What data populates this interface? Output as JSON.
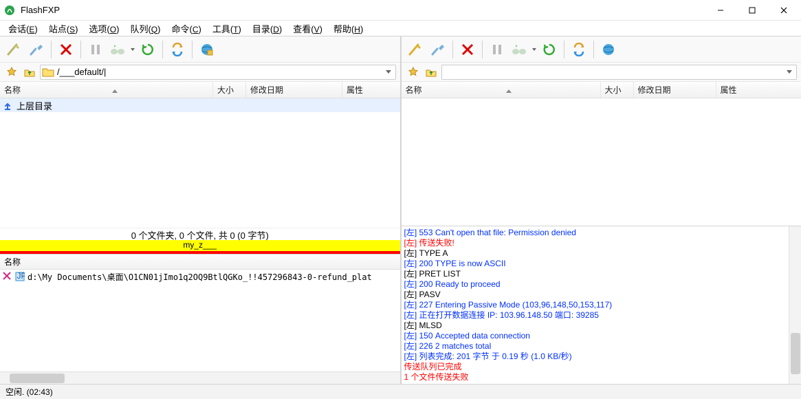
{
  "title": "FlashFXP",
  "menu": [
    {
      "l": "会话",
      "k": "E"
    },
    {
      "l": "站点",
      "k": "S"
    },
    {
      "l": "选项",
      "k": "O"
    },
    {
      "l": "队列",
      "k": "Q"
    },
    {
      "l": "命令",
      "k": "C"
    },
    {
      "l": "工具",
      "k": "T"
    },
    {
      "l": "目录",
      "k": "D"
    },
    {
      "l": "查看",
      "k": "V"
    },
    {
      "l": "帮助",
      "k": "H"
    }
  ],
  "left": {
    "path": "/___default/|",
    "cols": {
      "name": "名称",
      "size": "大小",
      "date": "修改日期",
      "attr": "属性"
    },
    "rows": [
      {
        "icon": "up",
        "name": "上层目录"
      }
    ],
    "summary": "0 个文件夹, 0 个文件, 共 0 (0 字节)",
    "highlight": "my_z___"
  },
  "right": {
    "path": "",
    "cols": {
      "name": "名称",
      "size": "大小",
      "date": "修改日期",
      "attr": "属性"
    }
  },
  "queue": {
    "header": "名称",
    "rows": [
      {
        "icon": "err",
        "img": "jpg",
        "path": "d:\\My Documents\\桌面\\O1CN01jImo1q2OQ9BtlQGKo_!!457296843-0-refund_plat"
      }
    ]
  },
  "log": [
    {
      "c": "blue",
      "t": "[左] 553 Can't open that file: Permission denied"
    },
    {
      "c": "red",
      "t": "[左] 传送失败!"
    },
    {
      "c": "black",
      "t": "[左] TYPE A"
    },
    {
      "c": "blue",
      "t": "[左] 200 TYPE is now ASCII"
    },
    {
      "c": "black",
      "t": "[左] PRET LIST"
    },
    {
      "c": "blue",
      "t": "[左] 200 Ready to proceed"
    },
    {
      "c": "black",
      "t": "[左] PASV"
    },
    {
      "c": "blue",
      "t": "[左] 227 Entering Passive Mode (103,96,148,50,153,117)"
    },
    {
      "c": "blue",
      "t": "[左] 正在打开数据连接 IP: 103.96.148.50 端口: 39285"
    },
    {
      "c": "black",
      "t": "[左] MLSD"
    },
    {
      "c": "blue",
      "t": "[左] 150 Accepted data connection"
    },
    {
      "c": "blue",
      "t": "[左] 226 2 matches total"
    },
    {
      "c": "blue",
      "t": "[左] 列表完成: 201 字节 于 0.19 秒 (1.0 KB/秒)"
    },
    {
      "c": "red",
      "t": "传送队列已完成"
    },
    {
      "c": "red",
      "t": "1 个文件传送失败"
    }
  ],
  "status": "空闲. (02:43)"
}
